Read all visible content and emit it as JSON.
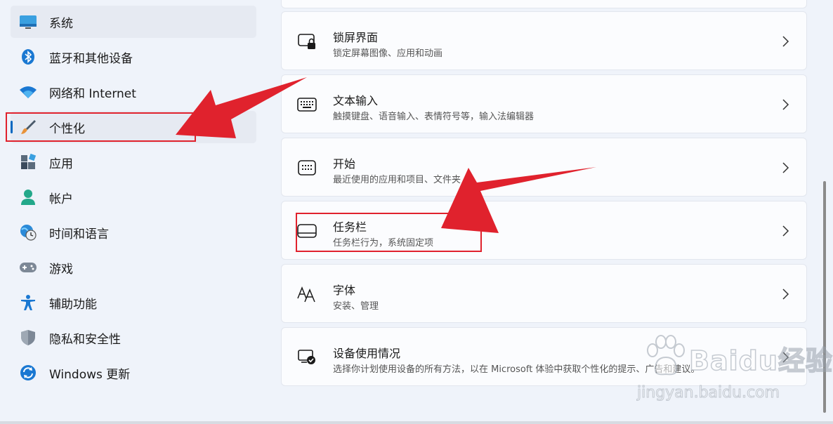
{
  "sidebar": {
    "items": [
      {
        "label": "系统",
        "icon": "monitor-icon"
      },
      {
        "label": "蓝牙和其他设备",
        "icon": "bluetooth-icon"
      },
      {
        "label": "网络和 Internet",
        "icon": "wifi-icon"
      },
      {
        "label": "个性化",
        "icon": "paintbrush-icon",
        "selected": true
      },
      {
        "label": "应用",
        "icon": "apps-icon"
      },
      {
        "label": "帐户",
        "icon": "account-icon"
      },
      {
        "label": "时间和语言",
        "icon": "globe-clock-icon"
      },
      {
        "label": "游戏",
        "icon": "gamepad-icon"
      },
      {
        "label": "辅助功能",
        "icon": "accessibility-icon"
      },
      {
        "label": "隐私和安全性",
        "icon": "shield-icon"
      },
      {
        "label": "Windows 更新",
        "icon": "update-icon"
      }
    ]
  },
  "settings": {
    "cards": [
      {
        "title": "锁屏界面",
        "desc": "锁定屏幕图像、应用和动画",
        "icon": "lock-screen-icon"
      },
      {
        "title": "文本输入",
        "desc": "触摸键盘、语音输入、表情符号等，输入法编辑器",
        "icon": "keyboard-icon"
      },
      {
        "title": "开始",
        "desc": "最近使用的应用和项目、文件夹",
        "icon": "start-menu-icon"
      },
      {
        "title": "任务栏",
        "desc": "任务栏行为，系统固定项",
        "icon": "taskbar-icon"
      },
      {
        "title": "字体",
        "desc": "安装、管理",
        "icon": "font-icon"
      },
      {
        "title": "设备使用情况",
        "desc": "选择你计划使用设备的所有方法，以在 Microsoft 体验中获取个性化的提示、广告和建议。",
        "icon": "device-usage-icon"
      }
    ]
  },
  "watermark": {
    "brand": "Baidu经验",
    "url": "jingyan.baidu.com"
  },
  "colors": {
    "accent": "#0067c0",
    "annotation": "#e0222d",
    "background": "#eff3fa",
    "card": "#fbfcfe"
  }
}
